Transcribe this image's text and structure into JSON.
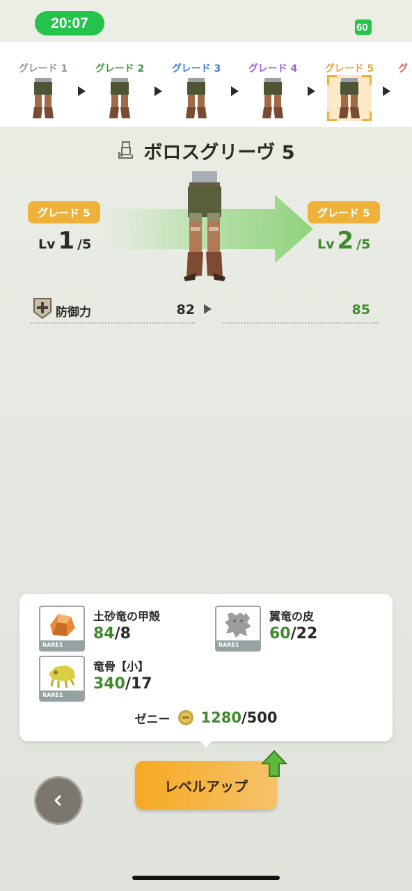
{
  "status_bar": {
    "time": "20:07",
    "battery": "60"
  },
  "grade_strip": {
    "items": [
      {
        "label": "グレード 1",
        "color": "#8a9a8f"
      },
      {
        "label": "グレード 2",
        "color": "#3b9b3a"
      },
      {
        "label": "グレード 3",
        "color": "#3b7fd0"
      },
      {
        "label": "グレード 4",
        "color": "#a05bd6"
      },
      {
        "label": "グレード 5",
        "color": "#e6a53a"
      },
      {
        "label": "グ",
        "color": "#e06060"
      }
    ],
    "selected_index": 4
  },
  "equipment": {
    "name": "ボロスグリーヴ 5"
  },
  "upgrade": {
    "current": {
      "grade": "グレード 5",
      "lv_prefix": "Lv",
      "level": "1",
      "max": "/5"
    },
    "next": {
      "grade": "グレード 5",
      "lv_prefix": "Lv",
      "level": "2",
      "max": "/5"
    }
  },
  "stats": [
    {
      "label": "防御力",
      "before": "82",
      "after": "85"
    }
  ],
  "materials": [
    {
      "name": "土砂竜の甲殻",
      "have": "84",
      "need": "/8",
      "rarity": "RARE1"
    },
    {
      "name": "翼竜の皮",
      "have": "60",
      "need": "/22",
      "rarity": "RARE1"
    },
    {
      "name": "竜骨【小】",
      "have": "340",
      "need": "/17",
      "rarity": "RARE1"
    }
  ],
  "zeny": {
    "label": "ゼニー",
    "have": "1280",
    "need": "/500"
  },
  "buttons": {
    "level_up": "レベルアップ",
    "back": "‹"
  },
  "colors": {
    "accent_green": "#3f8a2d",
    "badge_orange": "#eeb23a",
    "status_green": "#27c44d"
  }
}
